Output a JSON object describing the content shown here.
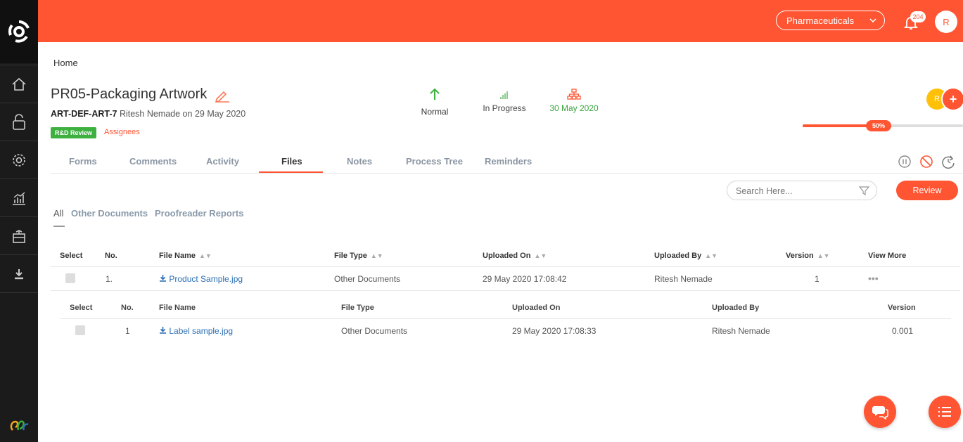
{
  "topbar": {
    "workspace": "Pharmaceuticals",
    "notification_count": "204",
    "user_initial": "R"
  },
  "breadcrumb": "Home",
  "job": {
    "title": "PR05-Packaging Artwork",
    "code": "ART-DEF-ART-7",
    "created_by": "Ritesh Nemade on 29 May 2020",
    "tag": "R&D Review",
    "assignees_label": "Assignees",
    "priority": "Normal",
    "status": "In Progress",
    "due_date": "30 May 2020",
    "progress_label": "50%",
    "progress_percent": 50,
    "assignee_initial": "R"
  },
  "tabs": [
    "Forms",
    "Comments",
    "Activity",
    "Files",
    "Notes",
    "Process Tree",
    "Reminders"
  ],
  "active_tab": "Files",
  "search": {
    "placeholder": "Search Here..."
  },
  "review_label": "Review",
  "subtabs": [
    "All",
    "Other Documents",
    "Proofreader Reports"
  ],
  "files_table": {
    "headers": [
      "Select",
      "No.",
      "File Name",
      "File Type",
      "Uploaded On",
      "Uploaded By",
      "Version",
      "View More"
    ],
    "rows": [
      {
        "no": "1.",
        "file_name": "Product Sample.jpg",
        "file_type": "Other Documents",
        "uploaded_on": "29 May 2020 17:08:42",
        "uploaded_by": "Ritesh Nemade",
        "version": "1",
        "more": "•••"
      }
    ]
  },
  "version_table": {
    "headers": [
      "Select",
      "No.",
      "File Name",
      "File Type",
      "Uploaded On",
      "Uploaded By",
      "Version"
    ],
    "rows": [
      {
        "no": "1",
        "file_name": "Label sample.jpg",
        "file_type": "Other Documents",
        "uploaded_on": "29 May 2020 17:08:33",
        "uploaded_by": "Ritesh Nemade",
        "version": "0.001"
      }
    ]
  },
  "colors": {
    "brand": "#ff5533",
    "sidebar": "#1b1b1b",
    "tag_green": "#3db040",
    "link": "#2c6fb3"
  }
}
